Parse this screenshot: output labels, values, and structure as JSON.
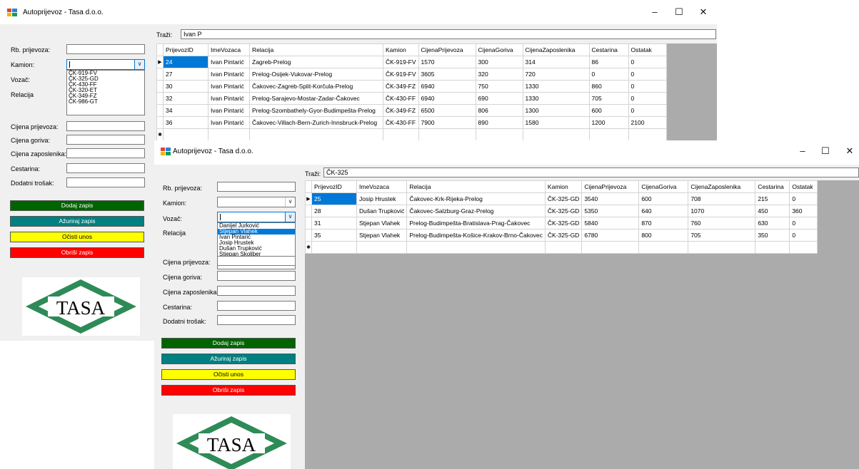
{
  "window_back": {
    "title": "Autoprijevoz - Tasa d.o.o.",
    "search_label": "Traži:",
    "search_value": "Ivan P",
    "form": {
      "rb_label": "Rb. prijevoza:",
      "kamion_label": "Kamion:",
      "vozac_label": "Vozač:",
      "relacija_label": "Relacija",
      "cijena_prijevoza_label": "Cijena prijevoza:",
      "cijena_goriva_label": "Cijena goriva:",
      "cijena_zaposlenika_label": "Cijena zaposlenika:",
      "cestarina_label": "Cestarina:",
      "dodatni_trosak_label": "Dodatni trošak:"
    },
    "kamion_options": [
      "ČK-919-FV",
      "ČK-325-GD",
      "ČK-430-FF",
      "ČK-320-ET",
      "ČK-349-FZ",
      "ČK-986-GT"
    ],
    "buttons": {
      "add": "Dodaj zapis",
      "update": "Ažuriraj zapis",
      "clear": "Očisti unos",
      "delete": "Obriši zapis"
    },
    "logo_text": "TASA",
    "columns": [
      "PrijevozID",
      "ImeVozaca",
      "Relacija",
      "Kamion",
      "CijenaPrijevoza",
      "CijenaGoriva",
      "CijenaZaposlenika",
      "Cestarina",
      "Ostatak"
    ],
    "rows": [
      [
        "24",
        "Ivan Pintarić",
        "Zagreb-Prelog",
        "ČK-919-FV",
        "1570",
        "300",
        "314",
        "86",
        "0"
      ],
      [
        "27",
        "Ivan Pintarić",
        "Prelog-Osijek-Vukovar-Prelog",
        "ČK-919-FV",
        "3605",
        "320",
        "720",
        "0",
        "0"
      ],
      [
        "30",
        "Ivan Pintarić",
        "Čakovec-Zagreb-Split-Korčula-Prelog",
        "ČK-349-FZ",
        "6940",
        "750",
        "1330",
        "860",
        "0"
      ],
      [
        "32",
        "Ivan Pintarić",
        "Prelog-Sarajevo-Mostar-Zadar-Čakovec",
        "ČK-430-FF",
        "6940",
        "690",
        "1330",
        "705",
        "0"
      ],
      [
        "34",
        "Ivan Pintarić",
        "Prelog-Szombathely-Gyor-Budimpešta-Prelog",
        "ČK-349-FZ",
        "6500",
        "806",
        "1300",
        "600",
        "0"
      ],
      [
        "36",
        "Ivan Pintarić",
        "Čakovec-Villach-Bern-Zurich-Innsbruck-Prelog",
        "ČK-430-FF",
        "7900",
        "890",
        "1580",
        "1200",
        "2100"
      ]
    ]
  },
  "window_front": {
    "title": "Autoprijevoz - Tasa d.o.o.",
    "search_label": "Traži:",
    "search_value": "ČK-325",
    "form": {
      "rb_label": "Rb. prijevoza:",
      "kamion_label": "Kamion:",
      "vozac_label": "Vozač:",
      "relacija_label": "Relacija",
      "cijena_prijevoza_label": "Cijena prijevoza:",
      "cijena_goriva_label": "Cijena goriva:",
      "cijena_zaposlenika_label": "Cijena zaposlenika:",
      "cestarina_label": "Cestarina:",
      "dodatni_trosak_label": "Dodatni trošak:"
    },
    "vozac_options": [
      "Danijel Jurković",
      "Stjepan Vlahek",
      "Ivan Pintarić",
      "Josip Hrustek",
      "Dušan Trupković",
      "Stjepan Skoliber"
    ],
    "buttons": {
      "add": "Dodaj zapis",
      "update": "Ažuriraj zapis",
      "clear": "Očisti unos",
      "delete": "Obriši zapis"
    },
    "logo_text": "TASA",
    "columns": [
      "PrijevozID",
      "ImeVozaca",
      "Relacija",
      "Kamion",
      "CijenaPrijevoza",
      "CijenaGoriva",
      "CijenaZaposlenika",
      "Cestarina",
      "Ostatak"
    ],
    "rows": [
      [
        "25",
        "Josip Hrustek",
        "Čakovec-Krk-Rijeka-Prelog",
        "ČK-325-GD",
        "3540",
        "600",
        "708",
        "215",
        "0"
      ],
      [
        "28",
        "Dušan Trupković",
        "Čakovec-Salzburg-Graz-Prelog",
        "ČK-325-GD",
        "5350",
        "640",
        "1070",
        "450",
        "360"
      ],
      [
        "31",
        "Stjepan Vlahek",
        "Prelog-Budimpešta-Bratislava-Prag-Čakovec",
        "ČK-325-GD",
        "5840",
        "870",
        "760",
        "630",
        "0"
      ],
      [
        "35",
        "Stjepan Vlahek",
        "Prelog-Budimpešta-Košice-Krakov-Brno-Čakovec",
        "ČK-325-GD",
        "6780",
        "800",
        "705",
        "350",
        "0"
      ]
    ]
  },
  "window_controls": {
    "minimize": "–",
    "maximize": "☐",
    "close": "✕"
  },
  "colors": {
    "add": "#006400",
    "update": "#008080",
    "clear": "#ffff00",
    "delete": "#ff0000",
    "selection": "#0078d7",
    "logo_green": "#2e8b57"
  }
}
